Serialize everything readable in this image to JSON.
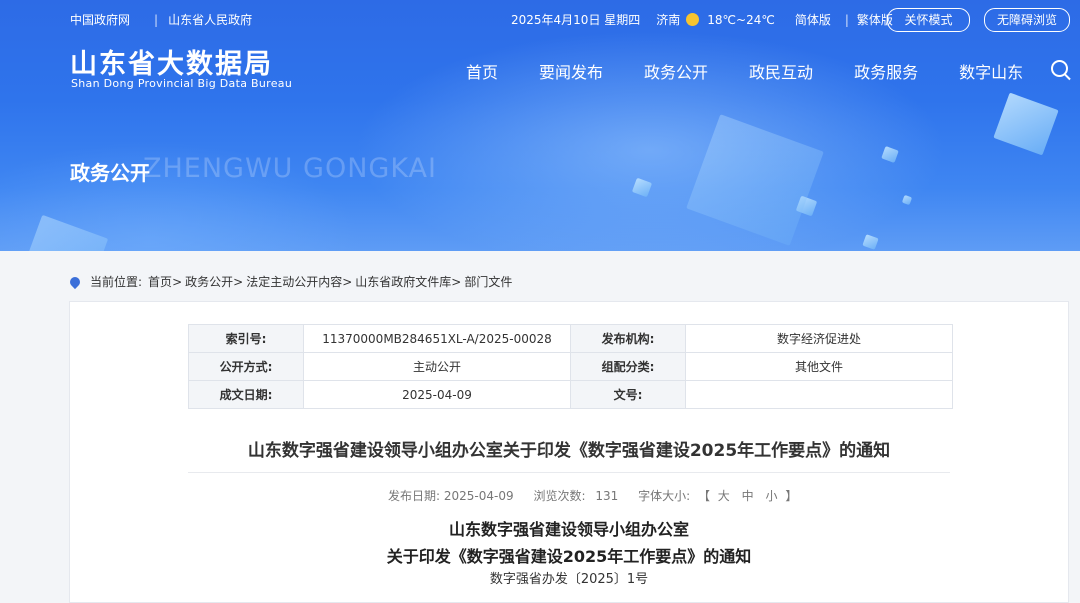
{
  "topbar": {
    "links": [
      "中国政府网",
      "山东省人民政府"
    ],
    "separator": "|",
    "date": "2025年4月10日 星期四",
    "city": "济南",
    "temperature": "18℃~24℃",
    "lang_simplified": "简体版",
    "lang_separator": "|",
    "lang_traditional": "繁体版",
    "care_mode": "关怀模式",
    "accessible": "无障碍浏览"
  },
  "logo": {
    "cn": "山东省大数据局",
    "en": "Shan Dong Provincial Big Data Bureau"
  },
  "nav": [
    "首页",
    "要闻发布",
    "政务公开",
    "政民互动",
    "政务服务",
    "数字山东"
  ],
  "section": {
    "title": "政务公开",
    "en": "ZHENGWU GONGKAI"
  },
  "breadcrumb": {
    "label": "当前位置:",
    "items": [
      "首页",
      "政务公开",
      "法定主动公开内容",
      "山东省政府文件库",
      "部门文件"
    ],
    "sep": ">"
  },
  "meta": {
    "rows": [
      [
        {
          "k": "索引号:",
          "v": "11370000MB284651XL-A/2025-00028"
        },
        {
          "k": "发布机构:",
          "v": "数字经济促进处"
        }
      ],
      [
        {
          "k": "公开方式:",
          "v": "主动公开"
        },
        {
          "k": "组配分类:",
          "v": "其他文件"
        }
      ],
      [
        {
          "k": "成文日期:",
          "v": "2025-04-09"
        },
        {
          "k": "文号:",
          "v": ""
        }
      ]
    ]
  },
  "doc": {
    "title": "山东数字强省建设领导小组办公室关于印发《数字强省建设2025年工作要点》的通知",
    "publish_label": "发布日期:",
    "publish_date": "2025-04-09",
    "views_label": "浏览次数:",
    "views": "131",
    "font_label": "字体大小:",
    "font_open": "【",
    "font_large": "大",
    "font_mid": "中",
    "font_small": "小",
    "font_close": "】",
    "heading1": "山东数字强省建设领导小组办公室",
    "heading2": "关于印发《数字强省建设2025年工作要点》的通知",
    "doc_number": "数字强省办发〔2025〕1号"
  }
}
